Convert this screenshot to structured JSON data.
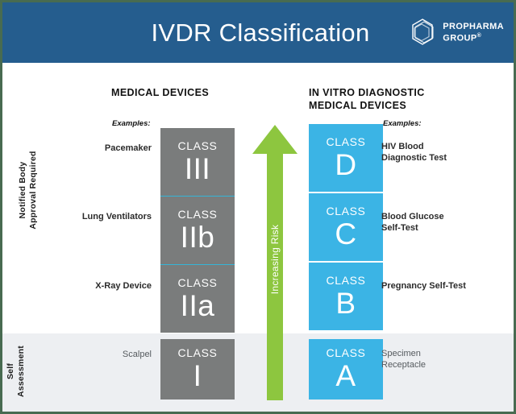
{
  "header": {
    "title": "IVDR Classification",
    "logo_name": "ProPharma Group hexagon logo",
    "logo_line1": "PROPHARMA",
    "logo_line2": "GROUP",
    "logo_reg": "®",
    "bar_color": "#255d8e"
  },
  "axis": {
    "notified_body": "Notified Body\nApproval Required",
    "notified_body_line1": "Notified Body",
    "notified_body_line2": "Approval Required",
    "self_assessment": "Self\nAssessment",
    "self_assessment_line1": "Self",
    "self_assessment_line2": "Assessment"
  },
  "columns": {
    "medical_devices": {
      "heading": "MEDICAL DEVICES",
      "examples_label": "Examples:",
      "box_color": "#7a7c7c"
    },
    "ivd_medical_devices": {
      "heading_line1": "IN VITRO DIAGNOSTIC",
      "heading_line2": "MEDICAL DEVICES",
      "examples_label": "Examples:",
      "box_color": "#3bb4e5"
    }
  },
  "arrow": {
    "label": "Increasing Risk",
    "color": "#8dc63f",
    "direction": "up"
  },
  "class_word": "CLASS",
  "medical_device_rows": [
    {
      "example": "Pacemaker",
      "class_label": "CLASS",
      "class_value": "III"
    },
    {
      "example": "Lung Ventilators",
      "class_label": "CLASS",
      "class_value": "IIb"
    },
    {
      "example": "X-Ray Device",
      "class_label": "CLASS",
      "class_value": "IIa"
    },
    {
      "example": "Scalpel",
      "class_label": "CLASS",
      "class_value": "I"
    }
  ],
  "ivd_rows": [
    {
      "class_label": "CLASS",
      "class_value": "D",
      "example_line1": "HIV Blood",
      "example_line2": "Diagnostic Test"
    },
    {
      "class_label": "CLASS",
      "class_value": "C",
      "example_line1": "Blood Glucose",
      "example_line2": "Self-Test"
    },
    {
      "class_label": "CLASS",
      "class_value": "B",
      "example_line1": "Pregnancy Self-Test",
      "example_line2": ""
    },
    {
      "class_label": "CLASS",
      "class_value": "A",
      "example_line1": "Specimen",
      "example_line2": "Receptacle"
    }
  ],
  "colors": {
    "border": "#486b51",
    "self_band": "#edeff2",
    "background": "#ffffff"
  }
}
